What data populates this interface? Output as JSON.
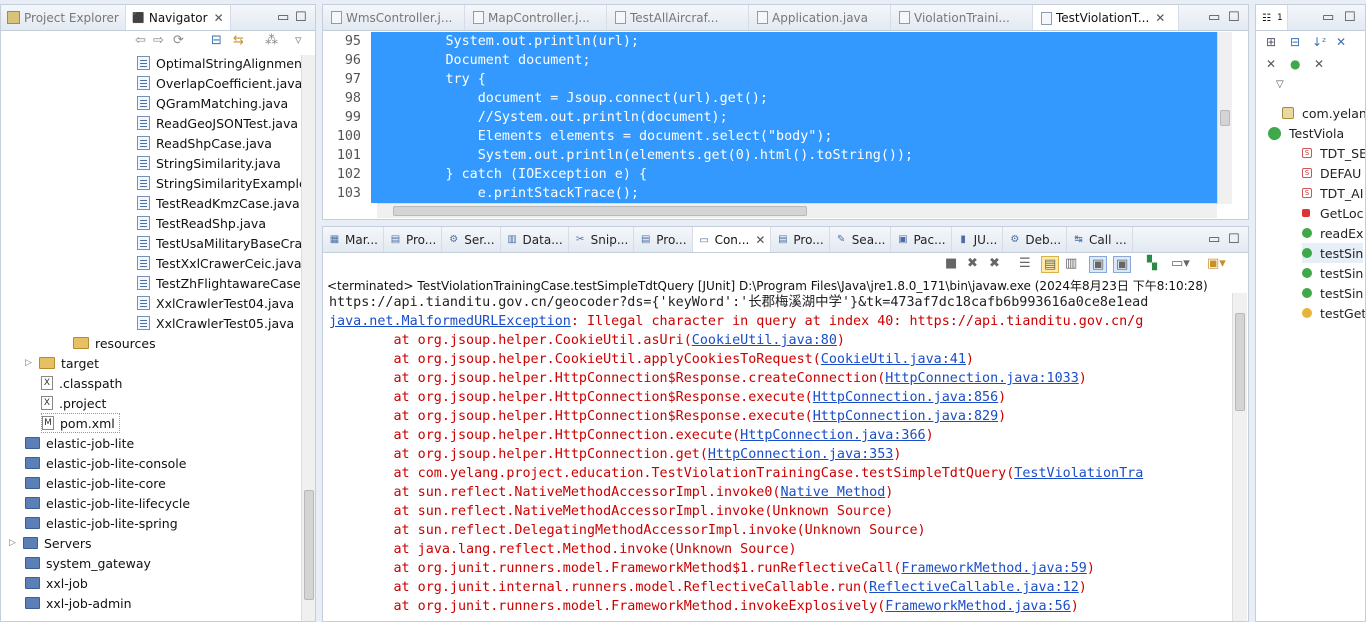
{
  "left": {
    "tabs": [
      {
        "label": "Project Explorer",
        "active": false
      },
      {
        "label": "Navigator",
        "active": true
      }
    ],
    "items": [
      {
        "label": "OptimalStringAlignmentD",
        "kind": "java",
        "indent": 1
      },
      {
        "label": "OverlapCoefficient.java",
        "kind": "java",
        "indent": 1
      },
      {
        "label": "QGramMatching.java",
        "kind": "java",
        "indent": 1
      },
      {
        "label": "ReadGeoJSONTest.java",
        "kind": "java",
        "indent": 1
      },
      {
        "label": "ReadShpCase.java",
        "kind": "java",
        "indent": 1
      },
      {
        "label": "StringSimilarity.java",
        "kind": "java",
        "indent": 1
      },
      {
        "label": "StringSimilarityExample.j",
        "kind": "java",
        "indent": 1
      },
      {
        "label": "TestReadKmzCase.java",
        "kind": "java",
        "indent": 1
      },
      {
        "label": "TestReadShp.java",
        "kind": "java",
        "indent": 1
      },
      {
        "label": "TestUsaMilitaryBaseCraw",
        "kind": "java",
        "indent": 1
      },
      {
        "label": "TestXxlCrawerCeic.java",
        "kind": "java",
        "indent": 1
      },
      {
        "label": "TestZhFlightawareCase.ja",
        "kind": "java",
        "indent": 1
      },
      {
        "label": "XxlCrawlerTest04.java",
        "kind": "java",
        "indent": 1
      },
      {
        "label": "XxlCrawlerTest05.java",
        "kind": "java",
        "indent": 1
      },
      {
        "label": "resources",
        "kind": "folder",
        "indent": 2
      },
      {
        "label": "target",
        "kind": "folder",
        "indent": 3,
        "arrow": true
      },
      {
        "label": ".classpath",
        "kind": "xfile",
        "indent": 4
      },
      {
        "label": ".project",
        "kind": "xfile",
        "indent": 4
      },
      {
        "label": "pom.xml",
        "kind": "mfile",
        "indent": 4
      },
      {
        "label": "elastic-job-lite",
        "kind": "project",
        "indent": 5
      },
      {
        "label": "elastic-job-lite-console",
        "kind": "project",
        "indent": 5
      },
      {
        "label": "elastic-job-lite-core",
        "kind": "project",
        "indent": 5
      },
      {
        "label": "elastic-job-lite-lifecycle",
        "kind": "project",
        "indent": 5
      },
      {
        "label": "elastic-job-lite-spring",
        "kind": "project",
        "indent": 5
      },
      {
        "label": "Servers",
        "kind": "project",
        "indent": 6,
        "arrow": true
      },
      {
        "label": "system_gateway",
        "kind": "project",
        "indent": 5
      },
      {
        "label": "xxl-job",
        "kind": "project",
        "indent": 5
      },
      {
        "label": "xxl-job-admin",
        "kind": "project",
        "indent": 5
      }
    ]
  },
  "editor": {
    "tabs": [
      "WmsController.j...",
      "MapController.j...",
      "TestAllAircraf...",
      "Application.java",
      "ViolationTraini...",
      "TestViolationT..."
    ],
    "lines": [
      {
        "n": "95",
        "t": "        System.out.println(url);"
      },
      {
        "n": "96",
        "t": "        Document document;"
      },
      {
        "n": "97",
        "t": "        try {"
      },
      {
        "n": "98",
        "t": "            document = Jsoup.connect(url).get();"
      },
      {
        "n": "99",
        "t": "            //System.out.println(document);"
      },
      {
        "n": "100",
        "t": "            Elements elements = document.select(\"body\");"
      },
      {
        "n": "101",
        "t": "            System.out.println(elements.get(0).html().toString());"
      },
      {
        "n": "102",
        "t": "        } catch (IOException e) {"
      },
      {
        "n": "103",
        "t": "            e.printStackTrace();"
      }
    ]
  },
  "console": {
    "tabs": [
      "Mar...",
      "Pro...",
      "Ser...",
      "Data...",
      "Snip...",
      "Pro...",
      "Con...",
      "Pro...",
      "Sea...",
      "Pac...",
      "JU...",
      "Deb...",
      "Call ..."
    ],
    "header": "<terminated> TestViolationTrainingCase.testSimpleTdtQuery [JUnit] D:\\Program Files\\Java\\jre1.8.0_171\\bin\\javaw.exe (2024年8月23日 下午8:10:28)",
    "url_line": "https://api.tianditu.gov.cn/geocoder?ds={'keyWord':'长郡梅溪湖中学'}&tk=473af7dc18cafb6b993616a0ce8e1ead",
    "exc_class": "java.net.MalformedURLException",
    "exc_msg": ": Illegal character in query at index 40: https://api.tianditu.gov.cn/g",
    "stack": [
      {
        "pre": "        at org.jsoup.helper.CookieUtil.asUri(",
        "link": "CookieUtil.java:80",
        "post": ")"
      },
      {
        "pre": "        at org.jsoup.helper.CookieUtil.applyCookiesToRequest(",
        "link": "CookieUtil.java:41",
        "post": ")"
      },
      {
        "pre": "        at org.jsoup.helper.HttpConnection$Response.createConnection(",
        "link": "HttpConnection.java:1033",
        "post": ")"
      },
      {
        "pre": "        at org.jsoup.helper.HttpConnection$Response.execute(",
        "link": "HttpConnection.java:856",
        "post": ")"
      },
      {
        "pre": "        at org.jsoup.helper.HttpConnection$Response.execute(",
        "link": "HttpConnection.java:829",
        "post": ")"
      },
      {
        "pre": "        at org.jsoup.helper.HttpConnection.execute(",
        "link": "HttpConnection.java:366",
        "post": ")"
      },
      {
        "pre": "        at org.jsoup.helper.HttpConnection.get(",
        "link": "HttpConnection.java:353",
        "post": ")"
      },
      {
        "pre": "        at com.yelang.project.education.TestViolationTrainingCase.testSimpleTdtQuery(",
        "link": "TestViolationTra",
        "post": ""
      },
      {
        "pre": "        at sun.reflect.NativeMethodAccessorImpl.invoke0(",
        "link": "Native Method",
        "post": ")"
      },
      {
        "pre": "        at sun.reflect.NativeMethodAccessorImpl.invoke(Unknown Source)",
        "link": "",
        "post": ""
      },
      {
        "pre": "        at sun.reflect.DelegatingMethodAccessorImpl.invoke(Unknown Source)",
        "link": "",
        "post": ""
      },
      {
        "pre": "        at java.lang.reflect.Method.invoke(Unknown Source)",
        "link": "",
        "post": ""
      },
      {
        "pre": "        at org.junit.runners.model.FrameworkMethod$1.runReflectiveCall(",
        "link": "FrameworkMethod.java:59",
        "post": ")"
      },
      {
        "pre": "        at org.junit.internal.runners.model.ReflectiveCallable.run(",
        "link": "ReflectiveCallable.java:12",
        "post": ")"
      },
      {
        "pre": "        at org.junit.runners.model.FrameworkMethod.invokeExplosively(",
        "link": "FrameworkMethod.java:56",
        "post": ")"
      }
    ]
  },
  "outline": {
    "items": [
      {
        "label": "com.yelan",
        "icon": "import-icon"
      },
      {
        "label": "TestViola",
        "icon": "class-icon"
      },
      {
        "label": "TDT_SE",
        "icon": "static-final-field-icon"
      },
      {
        "label": "DEFAU",
        "icon": "static-final-field-icon"
      },
      {
        "label": "TDT_AI",
        "icon": "static-final-field-icon"
      },
      {
        "label": "GetLoc",
        "icon": "private-field-icon"
      },
      {
        "label": "readEx",
        "icon": "public-method-icon"
      },
      {
        "label": "testSin",
        "icon": "public-method-icon"
      },
      {
        "label": "testSin",
        "icon": "public-method-icon"
      },
      {
        "label": "testSin",
        "icon": "public-method-icon"
      },
      {
        "label": "testGet",
        "icon": "test-method-icon"
      }
    ]
  }
}
